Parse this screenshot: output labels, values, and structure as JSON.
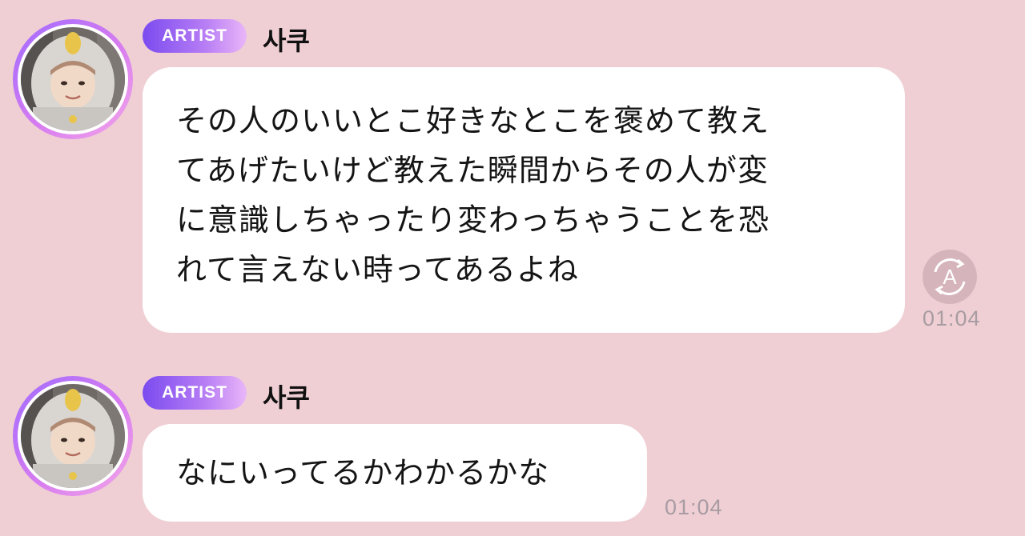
{
  "messages": [
    {
      "badge": "ARTIST",
      "name": "사쿠",
      "lines": [
        "その人のいいとこ好きなとこを褒めて教え",
        "てあげたいけど教えた瞬間からその人が変",
        "に意識しちゃったり変わっちゃうことを恐",
        "れて言えない時ってあるよね"
      ],
      "time": "01:04",
      "translate_icon_letter": "A"
    },
    {
      "badge": "ARTIST",
      "name": "사쿠",
      "lines": [
        "なにいってるかわかるかな"
      ],
      "time": "01:04"
    }
  ],
  "colors": {
    "background": "#efcfd4",
    "bubble": "#ffffff",
    "badge_start": "#7b4bef",
    "badge_end": "#e9b6f8",
    "time": "#a79ca2"
  }
}
